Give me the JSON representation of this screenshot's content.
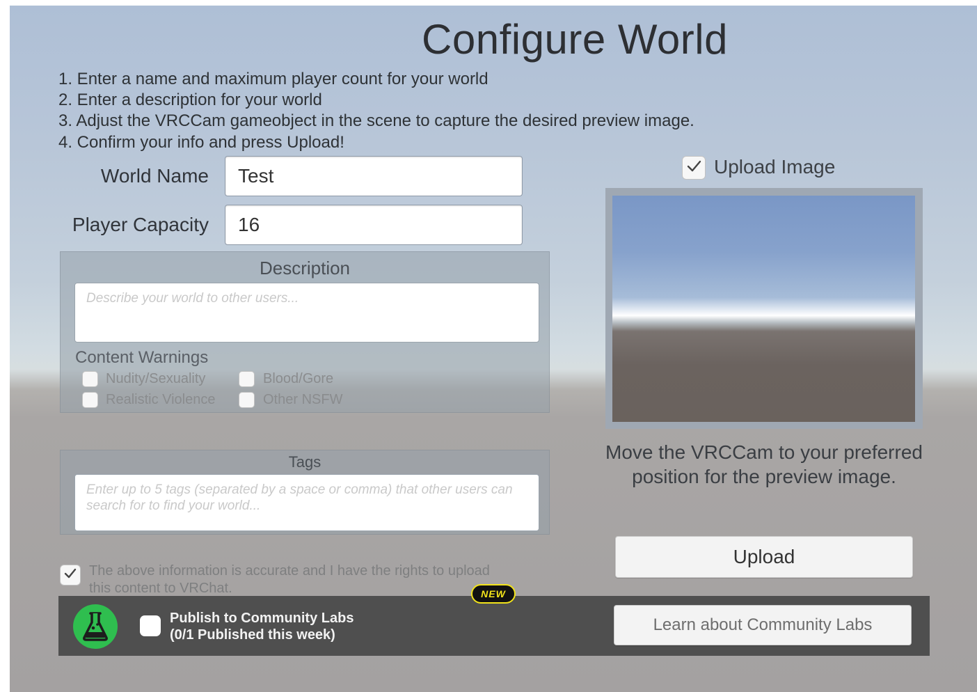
{
  "title": "Configure World",
  "steps": [
    "1. Enter a name and maximum player count for your world",
    "2. Enter a description for your world",
    "3. Adjust the VRCCam gameobject in the scene to capture the desired preview image.",
    "4. Confirm your info and press Upload!"
  ],
  "world_name": {
    "label": "World Name",
    "value": "Test"
  },
  "player_capacity": {
    "label": "Player Capacity",
    "value": "16"
  },
  "description": {
    "title": "Description",
    "placeholder": "Describe your world to other users..."
  },
  "content_warnings": {
    "title": "Content Warnings",
    "items": [
      {
        "label": "Nudity/Sexuality",
        "checked": false
      },
      {
        "label": "Blood/Gore",
        "checked": false
      },
      {
        "label": "Realistic Violence",
        "checked": false
      },
      {
        "label": "Other NSFW",
        "checked": false
      }
    ]
  },
  "tags": {
    "title": "Tags",
    "placeholder": "Enter up to 5 tags (separated by a space or comma) that other users can search for to find your world..."
  },
  "rights_confirmation": {
    "checked": true,
    "text": "The above information is accurate and I have the rights to upload this content to VRChat."
  },
  "upload_image": {
    "label": "Upload Image",
    "checked": true
  },
  "preview_caption": "Move the VRCCam to your preferred position for the preview image.",
  "upload_button": "Upload",
  "community_labs": {
    "new_badge": "NEW",
    "publish_label_line1": "Publish to Community Labs",
    "publish_label_line2": "(0/1 Published this week)",
    "publish_checked": false,
    "learn_button": "Learn about Community Labs",
    "icon": "flask-icon",
    "icon_color": "#2fbe4f"
  }
}
